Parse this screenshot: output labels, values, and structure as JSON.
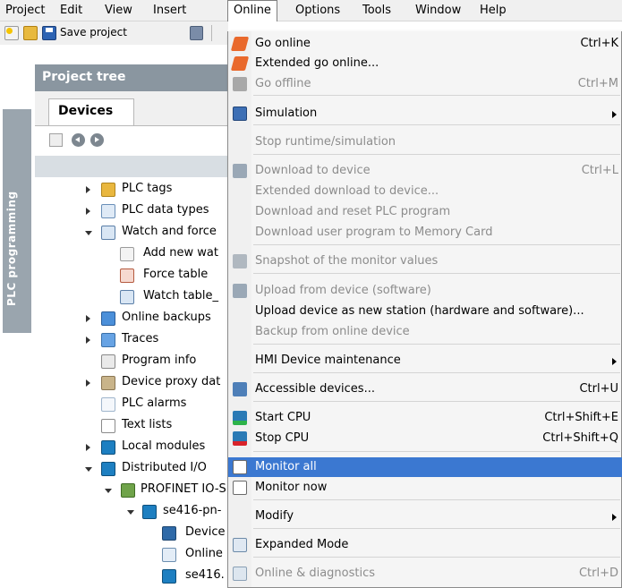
{
  "menubar": {
    "items": [
      "Project",
      "Edit",
      "View",
      "Insert",
      "Online",
      "Options",
      "Tools",
      "Window",
      "Help"
    ]
  },
  "toolbar": {
    "save_label": "Save project"
  },
  "sidetab": {
    "label": "PLC programming"
  },
  "project_tree": {
    "title": "Project tree",
    "tab": "Devices",
    "items": [
      "PLC tags",
      "PLC data types",
      "Watch and force",
      "Add new wat",
      "Force table",
      "Watch table_",
      "Online backups",
      "Traces",
      "Program info",
      "Device proxy dat",
      "PLC alarms",
      "Text lists",
      "Local modules",
      "Distributed I/O",
      "PROFINET IO-S",
      "se416-pn-",
      "Device",
      "Online",
      "se416."
    ]
  },
  "online_menu": {
    "items": [
      {
        "label": "Go online",
        "shortcut": "Ctrl+K",
        "icon": "go-online-icon",
        "enabled": true
      },
      {
        "label": "Extended go online...",
        "shortcut": "",
        "icon": "extended-go-online-icon",
        "enabled": true
      },
      {
        "label": "Go offline",
        "shortcut": "Ctrl+M",
        "icon": "go-offline-icon",
        "enabled": false
      },
      {
        "label": "Simulation",
        "shortcut": "",
        "icon": "simulation-icon",
        "enabled": true,
        "submenu": true
      },
      {
        "label": "Stop runtime/simulation",
        "shortcut": "",
        "icon": "",
        "enabled": false
      },
      {
        "label": "Download to device",
        "shortcut": "Ctrl+L",
        "icon": "download-icon",
        "enabled": false
      },
      {
        "label": "Extended download to device...",
        "shortcut": "",
        "icon": "",
        "enabled": false
      },
      {
        "label": "Download and reset PLC program",
        "shortcut": "",
        "icon": "",
        "enabled": false
      },
      {
        "label": "Download user program to Memory Card",
        "shortcut": "",
        "icon": "",
        "enabled": false
      },
      {
        "label": "Snapshot of the monitor values",
        "shortcut": "",
        "icon": "snapshot-icon",
        "enabled": false
      },
      {
        "label": "Upload from device (software)",
        "shortcut": "",
        "icon": "upload-icon",
        "enabled": false
      },
      {
        "label": "Upload device as new station (hardware and software)...",
        "shortcut": "",
        "icon": "",
        "enabled": true
      },
      {
        "label": "Backup from online device",
        "shortcut": "",
        "icon": "",
        "enabled": false
      },
      {
        "label": "HMI Device maintenance",
        "shortcut": "",
        "icon": "",
        "enabled": true,
        "submenu": true
      },
      {
        "label": "Accessible devices...",
        "shortcut": "Ctrl+U",
        "icon": "accessible-devices-icon",
        "enabled": true
      },
      {
        "label": "Start CPU",
        "shortcut": "Ctrl+Shift+E",
        "icon": "start-cpu-icon",
        "enabled": true
      },
      {
        "label": "Stop CPU",
        "shortcut": "Ctrl+Shift+Q",
        "icon": "stop-cpu-icon",
        "enabled": true
      },
      {
        "label": "Monitor all",
        "shortcut": "",
        "icon": "monitor-all-icon",
        "enabled": true,
        "highlighted": true
      },
      {
        "label": "Monitor now",
        "shortcut": "",
        "icon": "monitor-now-icon",
        "enabled": true
      },
      {
        "label": "Modify",
        "shortcut": "",
        "icon": "",
        "enabled": true,
        "submenu": true
      },
      {
        "label": "Expanded Mode",
        "shortcut": "",
        "icon": "expanded-mode-icon",
        "enabled": true
      },
      {
        "label": "Online & diagnostics",
        "shortcut": "Ctrl+D",
        "icon": "diagnostics-icon",
        "enabled": false
      }
    ]
  }
}
